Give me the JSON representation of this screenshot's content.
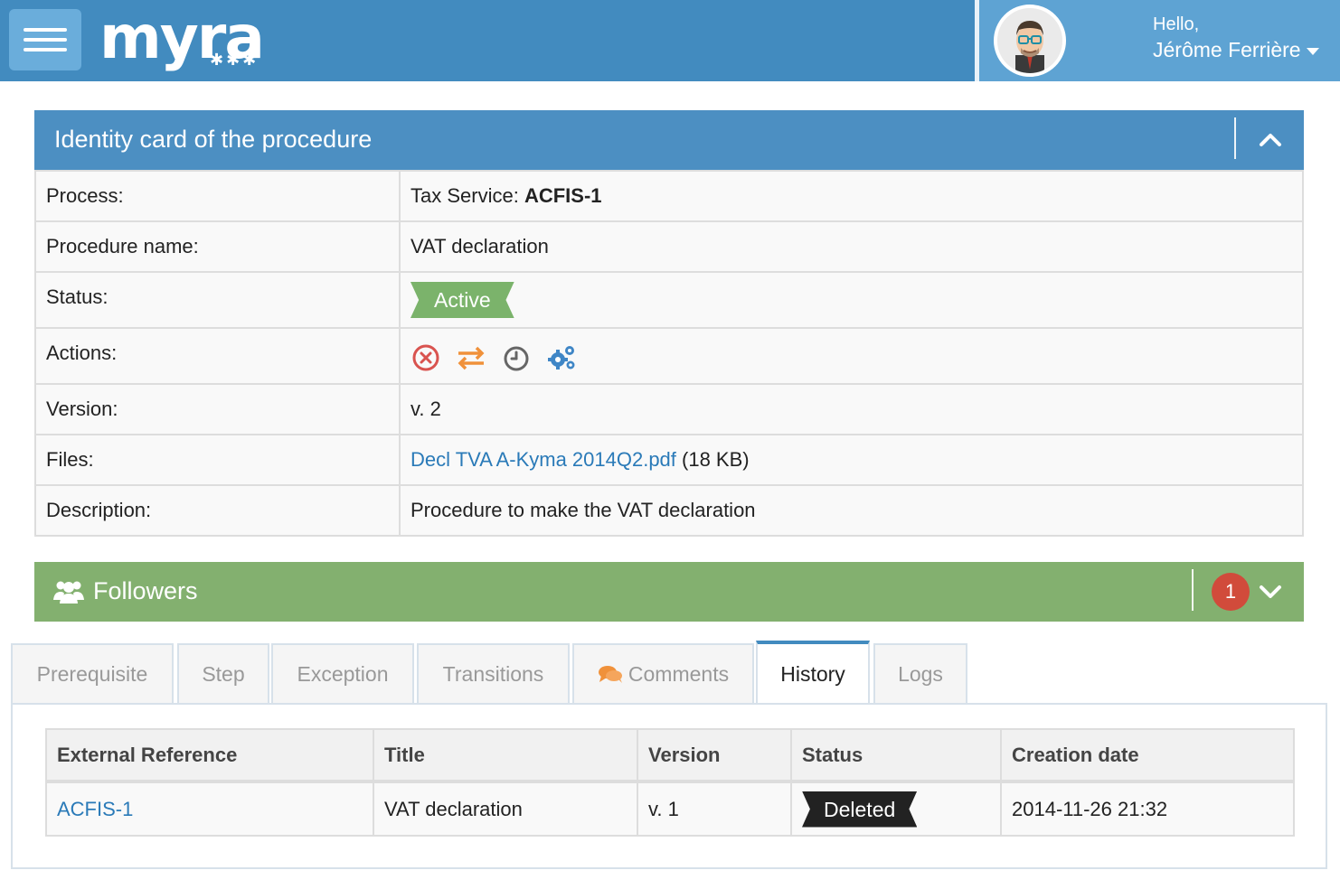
{
  "header": {
    "logo_text": "myra",
    "greeting": "Hello,",
    "user_name": "Jérôme Ferrière"
  },
  "identity_card": {
    "title": "Identity card of the procedure",
    "rows": {
      "process": {
        "label": "Process:",
        "prefix": "Tax Service: ",
        "code": "ACFIS-1"
      },
      "procedure_name": {
        "label": "Procedure name:",
        "value": "VAT declaration"
      },
      "status": {
        "label": "Status:",
        "value": "Active"
      },
      "actions": {
        "label": "Actions:",
        "icons": [
          "cancel-icon",
          "transfer-icon",
          "clock-icon",
          "settings-icon"
        ]
      },
      "version": {
        "label": "Version:",
        "value": "v. 2"
      },
      "files": {
        "label": "Files:",
        "file_name": "Decl TVA A-Kyma 2014Q2.pdf",
        "file_size": " (18 KB)"
      },
      "description": {
        "label": "Description:",
        "value": "Procedure to make the VAT declaration"
      }
    }
  },
  "followers": {
    "title": "Followers",
    "count": "1"
  },
  "tabs": [
    "Prerequisite",
    "Step",
    "Exception",
    "Transitions",
    "Comments",
    "History",
    "Logs"
  ],
  "active_tab": "History",
  "history_table": {
    "columns": [
      "External Reference",
      "Title",
      "Version",
      "Status",
      "Creation date"
    ],
    "rows": [
      {
        "external_reference": "ACFIS-1",
        "title": "VAT declaration",
        "version": "v. 1",
        "status": "Deleted",
        "creation_date": "2014-11-26 21:32"
      }
    ]
  },
  "colors": {
    "topbar": "#428bbf",
    "identity_header": "#4c8fc2",
    "followers_header": "#83b06f",
    "status_active": "#7bb36b",
    "status_deleted": "#222222",
    "badge": "#d14b3b",
    "link": "#2a7ab8"
  }
}
